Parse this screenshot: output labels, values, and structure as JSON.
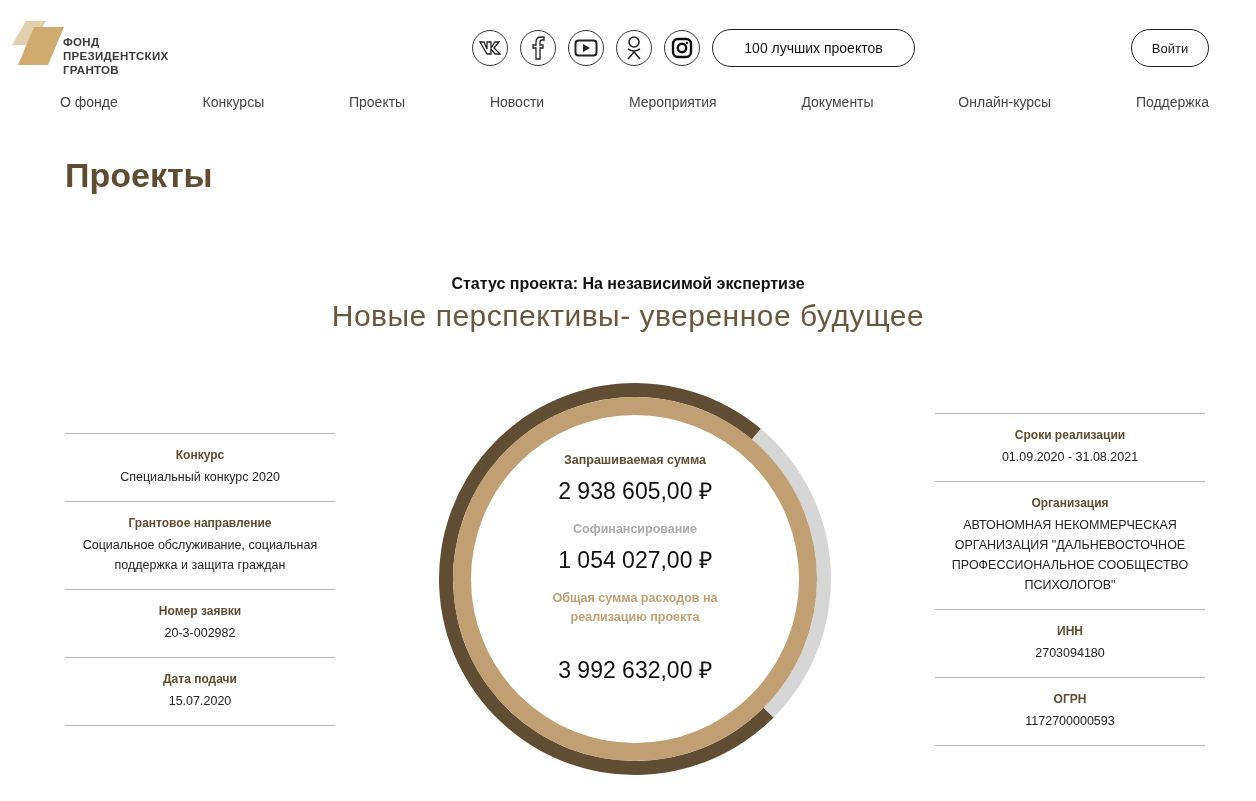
{
  "header": {
    "logo_lines": [
      "ФОНД",
      "ПРЕЗИДЕНТСКИХ",
      "ГРАНТОВ"
    ],
    "social": [
      {
        "kind": "vk"
      },
      {
        "kind": "facebook"
      },
      {
        "kind": "youtube"
      },
      {
        "kind": "ok"
      },
      {
        "kind": "instagram"
      }
    ],
    "best_button": "100 лучших проектов",
    "login_button": "Войти"
  },
  "nav": [
    "О фонде",
    "Конкурсы",
    "Проекты",
    "Новости",
    "Мероприятия",
    "Документы",
    "Онлайн-курсы",
    "Поддержка"
  ],
  "page_title": "Проекты",
  "status": "Статус проекта: На независимой экспертизе",
  "project_name": "Новые перспективы- уверенное будущее",
  "left_info": [
    {
      "label": "Конкурс",
      "value": "Специальный конкурс 2020"
    },
    {
      "label": "Грантовое направление",
      "value": "Социальное обслуживание, социальная поддержка и защита граждан"
    },
    {
      "label": "Номер заявки",
      "value": "20-3-002982"
    },
    {
      "label": "Дата подачи",
      "value": "15.07.2020"
    }
  ],
  "ring": {
    "chart_data": {
      "type": "donut",
      "values": [
        73.6,
        26.4
      ]
    },
    "amounts": [
      {
        "kind": "requested",
        "label": "Запрашиваемая сумма",
        "value": "2 938 605,00 ₽"
      },
      {
        "kind": "cofinancing",
        "label": "Софинансирование",
        "value": "1 054 027,00 ₽"
      },
      {
        "kind": "total",
        "label": "Общая сумма расходов на реализацию проекта",
        "value": "3 992 632,00 ₽"
      }
    ]
  },
  "right_info": [
    {
      "label": "Сроки реализации",
      "value": "01.09.2020 - 31.08.2021"
    },
    {
      "label": "Организация",
      "value": "АВТОНОМНАЯ НЕКОММЕРЧЕСКАЯ ОРГАНИЗАЦИЯ \"ДАЛЬНЕВОСТОЧНОЕ ПРОФЕССИОНАЛЬНОЕ СООБЩЕСТВО ПСИХОЛОГОВ\""
    },
    {
      "label": "ИНН",
      "value": "2703094180"
    },
    {
      "label": "ОГРН",
      "value": "1172700000593"
    }
  ]
}
